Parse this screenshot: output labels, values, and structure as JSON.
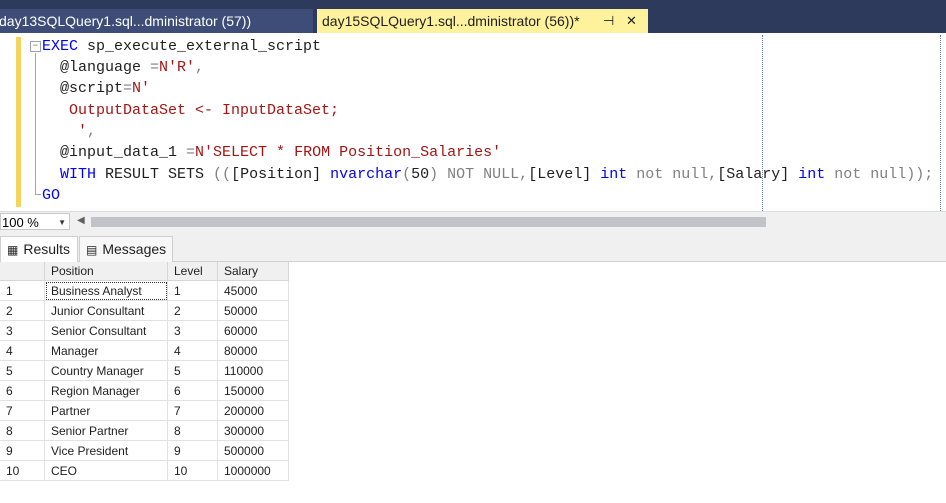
{
  "tabs": [
    {
      "label": "day13SQLQuery1.sql...dministrator (57))",
      "active": false
    },
    {
      "label": "day15SQLQuery1.sql...dministrator (56))*",
      "active": true
    }
  ],
  "tab_icons": {
    "pin": "⊣",
    "close": "✕"
  },
  "editor": {
    "line1": {
      "kw": "EXEC",
      "rest": " sp_execute_external_script"
    },
    "line2": {
      "param": "@language",
      "op": " =",
      "str": "N'R'",
      "comma": ","
    },
    "line3": {
      "param": "@script",
      "op": "=",
      "str": "N'"
    },
    "line4": {
      "str": " OutputDataSet <- InputDataSet;"
    },
    "line5": {
      "str": "  '",
      "comma": ","
    },
    "line6": {
      "param": "@input_data_1",
      "op": " =",
      "str": "N'SELECT * FROM Position_Salaries'"
    },
    "line7": {
      "kw1": "WITH",
      "t1": " RESULT SETS ",
      "p1": "((",
      "t2": "[Position] ",
      "kw2": "nvarchar",
      "p2": "(",
      "t3": "50",
      "p3": ") ",
      "g1": "NOT NULL",
      "p4": ",",
      "t4": "[Level] ",
      "kw3": "int",
      "g2": " not null",
      "p5": ",",
      "t5": "[Salary] ",
      "kw4": "int",
      "g3": " not null",
      "p6": "));"
    },
    "line8": {
      "kw": "GO"
    }
  },
  "zoom": "100 %",
  "result_tabs": {
    "results": "Results",
    "messages": "Messages"
  },
  "grid": {
    "columns": [
      "Position",
      "Level",
      "Salary"
    ],
    "rows": [
      [
        "1",
        "Business Analyst",
        "1",
        "45000"
      ],
      [
        "2",
        "Junior Consultant",
        "2",
        "50000"
      ],
      [
        "3",
        "Senior Consultant",
        "3",
        "60000"
      ],
      [
        "4",
        "Manager",
        "4",
        "80000"
      ],
      [
        "5",
        "Country Manager",
        "5",
        "110000"
      ],
      [
        "6",
        "Region Manager",
        "6",
        "150000"
      ],
      [
        "7",
        "Partner",
        "7",
        "200000"
      ],
      [
        "8",
        "Senior Partner",
        "8",
        "300000"
      ],
      [
        "9",
        "Vice President",
        "9",
        "500000"
      ],
      [
        "10",
        "CEO",
        "10",
        "1000000"
      ]
    ]
  }
}
